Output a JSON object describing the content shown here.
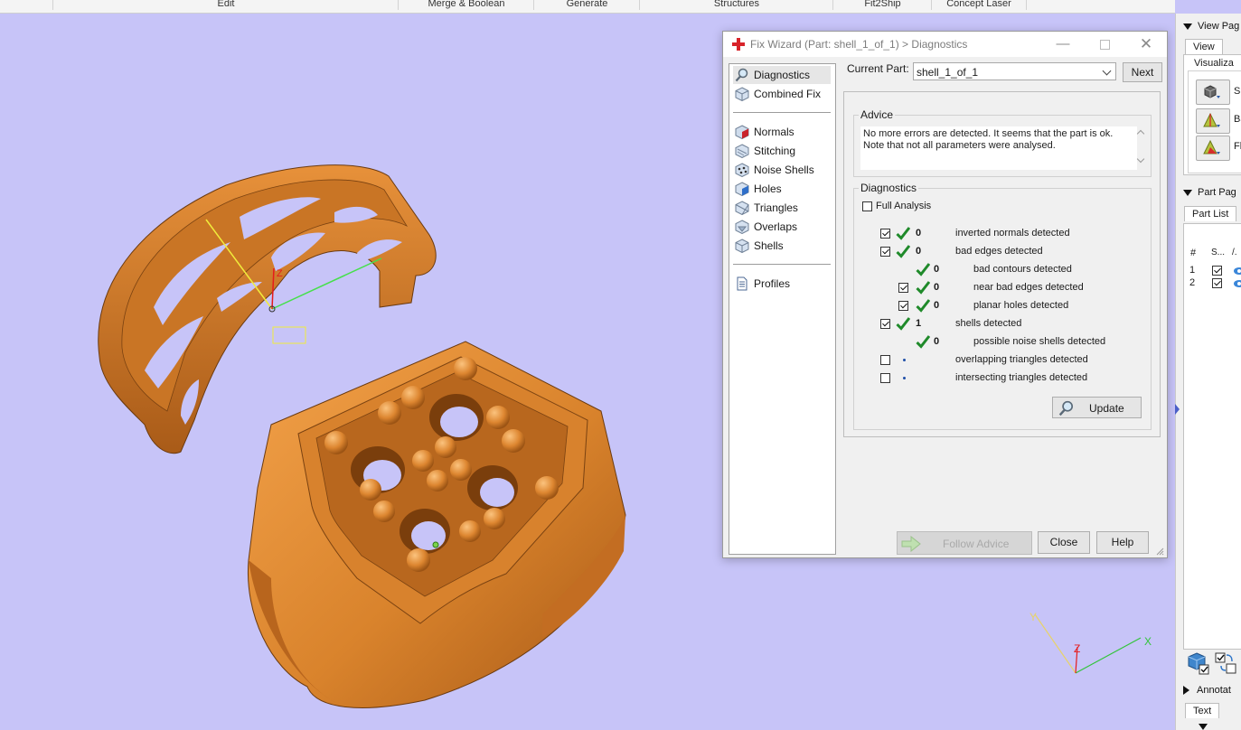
{
  "ribbon": {
    "groups": [
      "Edit",
      "Merge & Boolean",
      "Generate",
      "Structures",
      "Fit2Ship",
      "Concept Laser"
    ]
  },
  "viewport": {
    "bg_color": "#c7c4f8",
    "model_color": "#e08a2e",
    "axis_labels": {
      "z": "Z",
      "x": "X",
      "y": "Y"
    }
  },
  "dialog": {
    "title": "Fix Wizard (Part: shell_1_of_1) > Diagnostics",
    "nav": {
      "items": [
        {
          "label": "Diagnostics",
          "icon": "magnifier-icon",
          "selected": true
        },
        {
          "label": "Combined Fix",
          "icon": "cube-icon"
        },
        {
          "label": "Normals",
          "icon": "normals-cube-icon"
        },
        {
          "label": "Stitching",
          "icon": "stitching-cube-icon"
        },
        {
          "label": "Noise Shells",
          "icon": "noise-shells-icon"
        },
        {
          "label": "Holes",
          "icon": "holes-cube-icon"
        },
        {
          "label": "Triangles",
          "icon": "triangles-cube-icon"
        },
        {
          "label": "Overlaps",
          "icon": "overlaps-cube-icon"
        },
        {
          "label": "Shells",
          "icon": "shells-cube-icon"
        },
        {
          "label": "Profiles",
          "icon": "document-icon"
        }
      ]
    },
    "current_part": {
      "label": "Current Part:",
      "value": "shell_1_of_1",
      "next_label": "Next"
    },
    "advice": {
      "title": "Advice",
      "line1": "No more errors are detected. It seems that the part is ok.",
      "line2": "Note that not all parameters were analysed."
    },
    "diagnostics": {
      "title": "Diagnostics",
      "full_analysis_label": "Full Analysis",
      "rows": [
        {
          "count": "0",
          "label": "inverted normals detected"
        },
        {
          "count": "0",
          "label": "bad edges detected"
        },
        {
          "count": "0",
          "label": "bad contours detected"
        },
        {
          "count": "0",
          "label": "near bad edges detected"
        },
        {
          "count": "0",
          "label": "planar holes detected"
        },
        {
          "count": "1",
          "label": "shells detected"
        },
        {
          "count": "0",
          "label": "possible noise shells detected"
        },
        {
          "count": "",
          "label": "overlapping triangles detected"
        },
        {
          "count": "",
          "label": "intersecting triangles detected"
        }
      ],
      "update_label": "Update"
    },
    "buttons": {
      "follow_advice": "Follow Advice",
      "close": "Close",
      "help": "Help"
    }
  },
  "dock": {
    "view_page_title": "View Pag",
    "view_tab": "View",
    "visualization_label": "Visualiza",
    "vis_buttons": [
      {
        "icon": "solid-cube-icon",
        "label": "Sh"
      },
      {
        "icon": "bad-edges-icon",
        "label": "Ba"
      },
      {
        "icon": "flip-triangles-icon",
        "label": "Fli"
      }
    ],
    "part_page_title": "Part Pag",
    "part_list_tab": "Part List",
    "part_list_headers": [
      "#",
      "S...",
      "/."
    ],
    "part_rows": [
      "1",
      "2"
    ],
    "annotations_title": "Annotat",
    "text_tab": "Text"
  }
}
